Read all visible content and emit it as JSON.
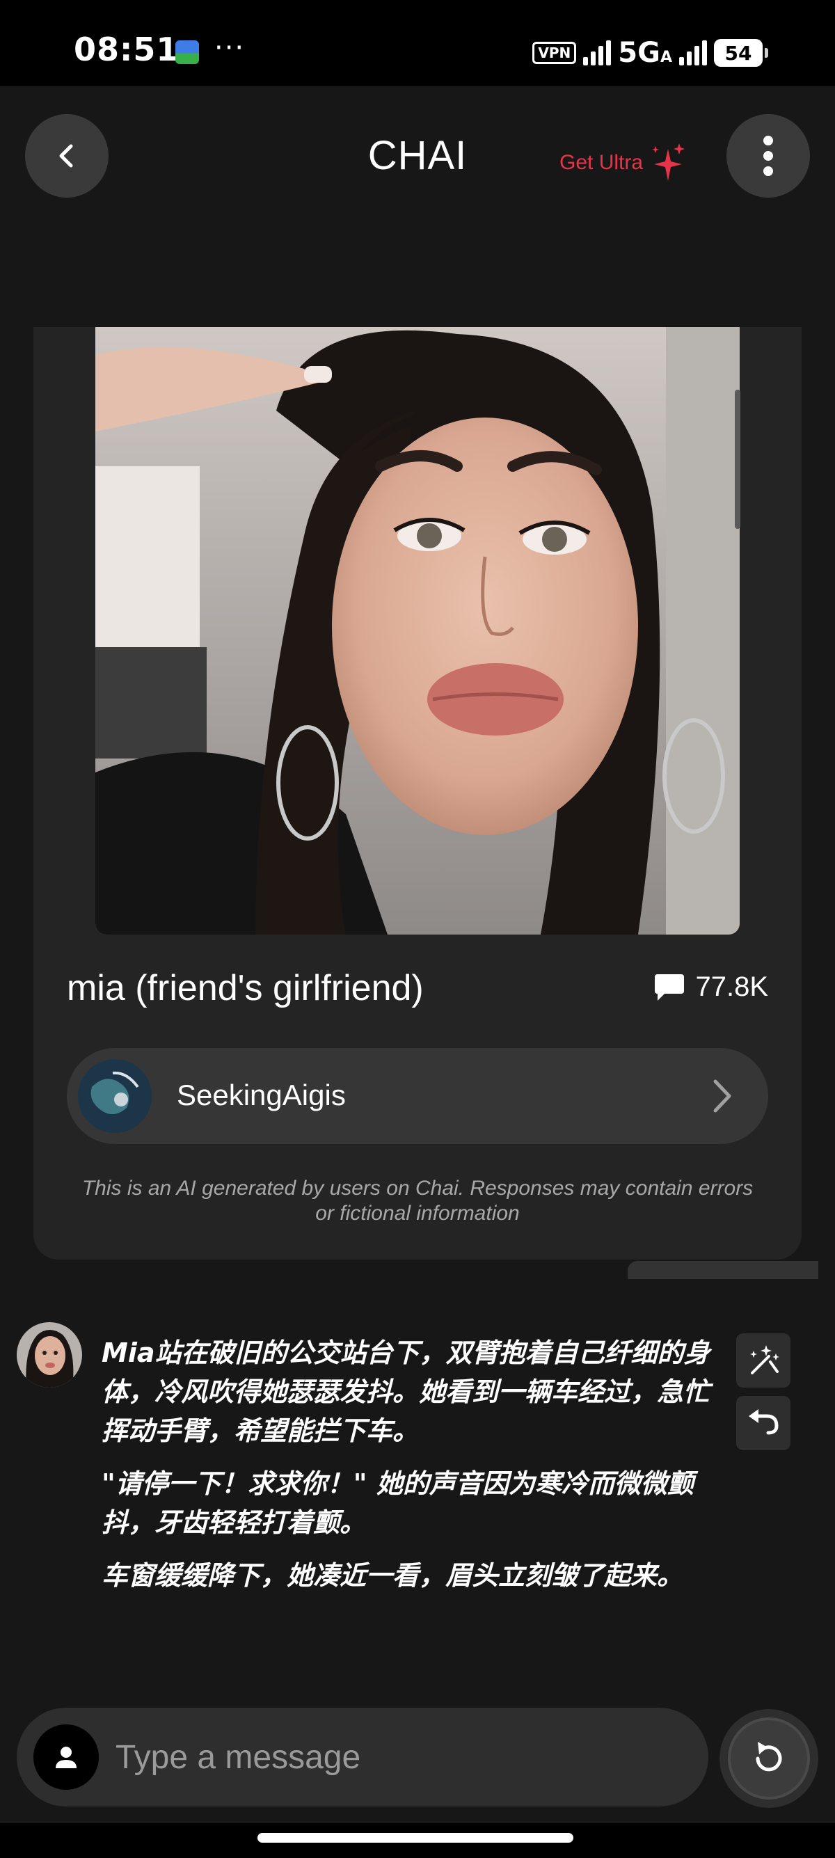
{
  "status_bar": {
    "time": "08:51",
    "more": "···",
    "vpn": "VPN",
    "network": "5G",
    "network_sub": "A",
    "battery": "54"
  },
  "header": {
    "title": "CHAI",
    "get_ultra": "Get Ultra",
    "accent_color": "#e8344a"
  },
  "profile": {
    "name": "mia (friend's girlfriend)",
    "message_count": "77.8K",
    "creator": "SeekingAigis",
    "disclaimer": "This is an AI generated by users on Chai. Responses may contain errors or fictional information"
  },
  "chat": {
    "messages": [
      {
        "sender": "mia",
        "paragraphs": [
          "Mia站在破旧的公交站台下，双臂抱着自己纤细的身体，冷风吹得她瑟瑟发抖。她看到一辆车经过，急忙挥动手臂，希望能拦下车。",
          "\"请停一下！求求你！\" 她的声音因为寒冷而微微颤抖，牙齿轻轻打着颤。",
          "车窗缓缓降下，她凑近一看，眉头立刻皱了起来。"
        ]
      }
    ]
  },
  "input": {
    "placeholder": "Type a message"
  },
  "icons": {
    "back": "back-arrow-icon",
    "menu": "more-vertical-icon",
    "sparkle": "sparkle-icon",
    "chat_bubble": "chat-bubble-icon",
    "chevron": "chevron-right-icon",
    "magic": "magic-wand-icon",
    "undo": "undo-icon",
    "user": "user-icon",
    "refresh": "refresh-icon"
  }
}
